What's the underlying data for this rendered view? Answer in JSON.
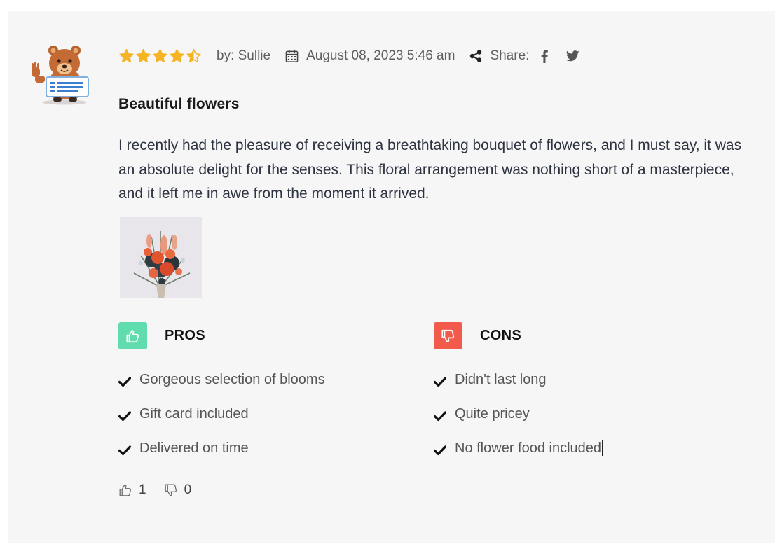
{
  "review": {
    "rating": 4.5,
    "rating_max": 5,
    "author": "by: Sullie",
    "date": "August 08, 2023 5:46 am",
    "share_label": "Share:",
    "share_networks": [
      "facebook-icon",
      "twitter-icon"
    ],
    "title": "Beautiful flowers",
    "body": "I recently had the pleasure of receiving a breathtaking bouquet of flowers, and I must say, it was an absolute delight for the senses. This floral arrangement was nothing short of a masterpiece, and it left me in awe from the moment it arrived.",
    "pros": {
      "heading": "PROS",
      "items": [
        "Gorgeous selection of blooms",
        "Gift card included",
        "Delivered on time"
      ]
    },
    "cons": {
      "heading": "CONS",
      "items": [
        "Didn't last long",
        "Quite pricey",
        "No flower food included"
      ]
    },
    "votes": {
      "up": "1",
      "down": "0"
    }
  },
  "colors": {
    "star": "#f5b423",
    "pros_badge": "#61dcae",
    "cons_badge": "#f25a4c",
    "card_background": "#f7f6f7",
    "meta_text": "#5f5f5f"
  },
  "icons": {
    "rating": "star-icon",
    "date": "calendar-icon",
    "share": "share-icon",
    "pros": "thumbs-up-icon",
    "cons": "thumbs-down-icon",
    "list_bullet": "check-icon",
    "vote_up": "thumbs-up-outline-icon",
    "vote_down": "thumbs-down-outline-icon"
  }
}
